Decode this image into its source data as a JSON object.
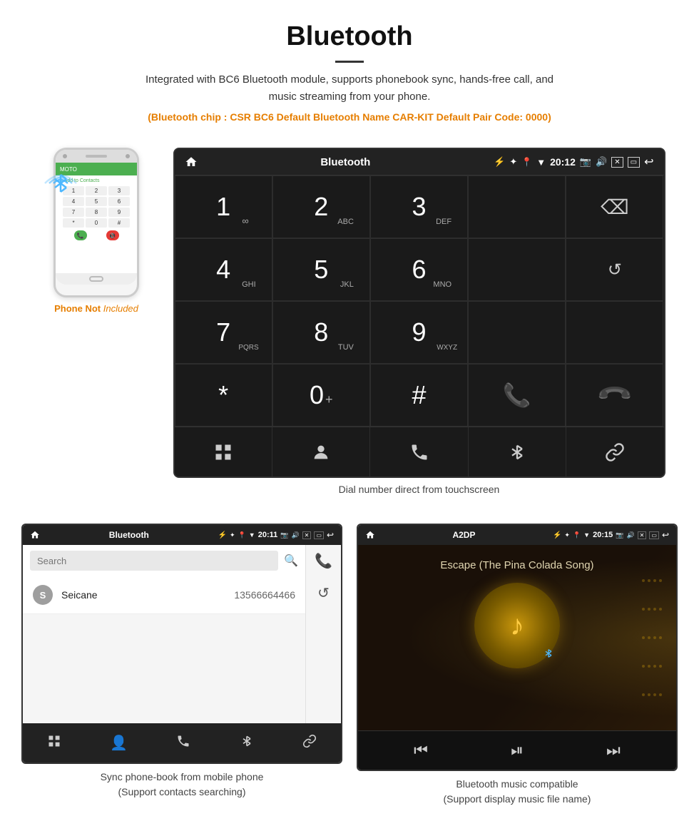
{
  "page": {
    "title": "Bluetooth",
    "divider": true,
    "description": "Integrated with BC6 Bluetooth module, supports phonebook sync, hands-free call, and music streaming from your phone.",
    "specs": "(Bluetooth chip : CSR BC6    Default Bluetooth Name CAR-KIT    Default Pair Code: 0000)"
  },
  "main_screen": {
    "status_bar": {
      "title": "Bluetooth",
      "time": "20:12",
      "usb_icon": "⚡",
      "home_icon": "🏠"
    },
    "dialpad": {
      "keys": [
        {
          "number": "1",
          "sub": "∞",
          "col": 1
        },
        {
          "number": "2",
          "sub": "ABC",
          "col": 2
        },
        {
          "number": "3",
          "sub": "DEF",
          "col": 3
        },
        {
          "number": "4",
          "sub": "GHI",
          "col": 1
        },
        {
          "number": "5",
          "sub": "JKL",
          "col": 2
        },
        {
          "number": "6",
          "sub": "MNO",
          "col": 3
        },
        {
          "number": "7",
          "sub": "PQRS",
          "col": 1
        },
        {
          "number": "8",
          "sub": "TUV",
          "col": 2
        },
        {
          "number": "9",
          "sub": "WXYZ",
          "col": 3
        },
        {
          "number": "*",
          "sub": "",
          "col": 1
        },
        {
          "number": "0",
          "sub": "+",
          "col": 2
        },
        {
          "number": "#",
          "sub": "",
          "col": 3
        }
      ]
    },
    "caption": "Dial number direct from touchscreen"
  },
  "phone": {
    "not_included_text": "Phone Not Included",
    "signal_icon": "📶"
  },
  "phonebook_screen": {
    "status_title": "Bluetooth",
    "time": "20:11",
    "search_placeholder": "Search",
    "contact_name": "Seicane",
    "contact_initial": "S",
    "contact_phone": "13566664466",
    "caption_line1": "Sync phone-book from mobile phone",
    "caption_line2": "(Support contacts searching)"
  },
  "music_screen": {
    "status_title": "A2DP",
    "time": "20:15",
    "song_title": "Escape (The Pina Colada Song)",
    "caption_line1": "Bluetooth music compatible",
    "caption_line2": "(Support display music file name)"
  }
}
